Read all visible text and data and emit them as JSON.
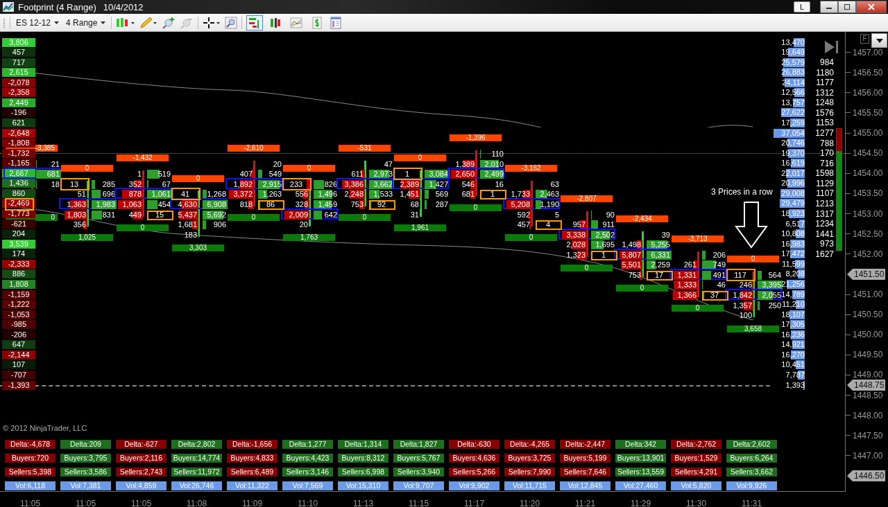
{
  "window": {
    "title": "Footprint (4 Range)",
    "date": "10/4/2012",
    "layout_button": "L"
  },
  "toolbar": {
    "instrument": "ES 12-12",
    "period": "4 Range",
    "chart_styles": [
      {
        "selected": true
      },
      {
        "selected": false
      },
      {
        "selected": false
      },
      {
        "selected": false
      }
    ]
  },
  "corner_button": "F",
  "delta_ladder": [
    "3,806",
    "457",
    "717",
    "2,615",
    "-2,078",
    "-2,358",
    "2,449",
    "-196",
    "621",
    "-2,648",
    "-1,808",
    "-1,732",
    "-1,165",
    "2,667",
    "1,436",
    "860",
    "-2,469",
    "-1,773",
    "-621",
    "204",
    "3,539",
    "174",
    "-2,333",
    "886",
    "1,808",
    "-1,159",
    "-1,222",
    "-1,053",
    "-985",
    "-206",
    "647",
    "-2,144",
    "107",
    "-707",
    "-1,393"
  ],
  "bars": [
    {
      "header": "-3,385",
      "footer": "0",
      "rows": [
        null,
        null,
        null,
        null,
        null,
        null,
        null,
        null,
        null,
        null,
        null,
        null,
        {
          "ask": "21",
          "imbalance": false,
          "bid_outlined": false,
          "ask_outlined": false
        },
        {
          "ask": "681",
          "imbalance": true,
          "bid_outlined": false,
          "ask_outlined": false
        },
        {
          "ask": "18",
          "imbalance": false,
          "bid_outlined": false,
          "ask_outlined": false
        },
        null,
        {
          "imbalance": false,
          "bid_outlined": true,
          "ask_outlined": false
        }
      ]
    },
    {
      "header": "0",
      "footer": "1,025",
      "rows": [
        null,
        null,
        null,
        null,
        null,
        null,
        null,
        null,
        null,
        null,
        null,
        null,
        null,
        null,
        {
          "bid": "13",
          "ask": "285",
          "imbalance": false,
          "bid_outlined": true,
          "ask_outlined": false
        },
        {
          "bid": "51",
          "ask": "696",
          "imbalance": false,
          "bid_outlined": false,
          "ask_outlined": false
        },
        {
          "bid": "1,363",
          "ask": "1,983",
          "imbalance": true,
          "bid_outlined": false,
          "ask_outlined": false
        },
        {
          "bid": "1,803",
          "ask": "831",
          "imbalance": false,
          "bid_outlined": false,
          "ask_outlined": false
        },
        {
          "bid": "356",
          "imbalance": false,
          "bid_outlined": false,
          "ask_outlined": false
        }
      ]
    },
    {
      "header": "-1,432",
      "footer": "0",
      "rows": [
        null,
        null,
        null,
        null,
        null,
        null,
        null,
        null,
        null,
        null,
        null,
        null,
        null,
        {
          "bid": "1",
          "ask": "519",
          "imbalance": false,
          "bid_outlined": false,
          "ask_outlined": false
        },
        {
          "bid": "352",
          "ask": "67",
          "imbalance": false,
          "bid_outlined": false,
          "ask_outlined": false
        },
        {
          "bid": "878",
          "ask": "1,061",
          "imbalance": true,
          "bid_outlined": false,
          "ask_outlined": false
        },
        {
          "bid": "1,063",
          "ask": "454",
          "imbalance": false,
          "bid_outlined": false,
          "ask_outlined": false
        },
        {
          "bid": "449",
          "ask": "15",
          "imbalance": false,
          "bid_outlined": false,
          "ask_outlined": true
        }
      ]
    },
    {
      "header": "0",
      "footer": "3,303",
      "rows": [
        null,
        null,
        null,
        null,
        null,
        null,
        null,
        null,
        null,
        null,
        null,
        null,
        null,
        null,
        null,
        {
          "bid": "41",
          "ask": "1,268",
          "imbalance": false,
          "bid_outlined": true,
          "ask_outlined": false
        },
        {
          "bid": "4,630",
          "ask": "6,908",
          "imbalance": true,
          "bid_outlined": false,
          "ask_outlined": false
        },
        {
          "bid": "5,437",
          "ask": "5,692",
          "imbalance": false,
          "bid_outlined": false,
          "ask_outlined": false
        },
        {
          "bid": "1,681",
          "ask": "906",
          "imbalance": false,
          "bid_outlined": false,
          "ask_outlined": false
        },
        {
          "bid": "183",
          "imbalance": false,
          "bid_outlined": false,
          "ask_outlined": false
        }
      ]
    },
    {
      "header": "-2,610",
      "footer": "0",
      "rows": [
        null,
        null,
        null,
        null,
        null,
        null,
        null,
        null,
        null,
        null,
        null,
        null,
        {
          "ask": "20",
          "imbalance": false,
          "bid_outlined": false,
          "ask_outlined": false
        },
        {
          "bid": "407",
          "ask": "549",
          "imbalance": false,
          "bid_outlined": false,
          "ask_outlined": false
        },
        {
          "bid": "1,892",
          "ask": "2,915",
          "imbalance": true,
          "bid_outlined": false,
          "ask_outlined": false
        },
        {
          "bid": "3,372",
          "ask": "1,263",
          "imbalance": false,
          "bid_outlined": false,
          "ask_outlined": false
        },
        {
          "bid": "818",
          "ask": "86",
          "imbalance": false,
          "bid_outlined": false,
          "ask_outlined": true
        }
      ]
    },
    {
      "header": "0",
      "footer": "1,763",
      "rows": [
        null,
        null,
        null,
        null,
        null,
        null,
        null,
        null,
        null,
        null,
        null,
        null,
        null,
        null,
        {
          "bid": "233",
          "ask": "826",
          "imbalance": false,
          "bid_outlined": true,
          "ask_outlined": false
        },
        {
          "bid": "556",
          "ask": "1,496",
          "imbalance": false,
          "bid_outlined": false,
          "ask_outlined": false
        },
        {
          "bid": "328",
          "ask": "1,459",
          "imbalance": false,
          "bid_outlined": false,
          "ask_outlined": false
        },
        {
          "bid": "2,009",
          "ask": "642",
          "imbalance": true,
          "bid_outlined": false,
          "ask_outlined": false
        },
        {
          "bid": "20",
          "imbalance": false,
          "bid_outlined": false,
          "ask_outlined": false
        }
      ]
    },
    {
      "header": "-531",
      "footer": "0",
      "rows": [
        null,
        null,
        null,
        null,
        null,
        null,
        null,
        null,
        null,
        null,
        null,
        null,
        {
          "ask": "47",
          "imbalance": false,
          "bid_outlined": false,
          "ask_outlined": false
        },
        {
          "bid": "611",
          "ask": "2,973",
          "imbalance": false,
          "bid_outlined": false,
          "ask_outlined": false
        },
        {
          "bid": "3,386",
          "ask": "3,662",
          "imbalance": true,
          "bid_outlined": false,
          "ask_outlined": false
        },
        {
          "bid": "2,248",
          "ask": "1,533",
          "imbalance": false,
          "bid_outlined": false,
          "ask_outlined": false
        },
        {
          "bid": "753",
          "ask": "92",
          "imbalance": false,
          "bid_outlined": false,
          "ask_outlined": true
        }
      ]
    },
    {
      "header": "0",
      "footer": "1,961",
      "rows": [
        null,
        null,
        null,
        null,
        null,
        null,
        null,
        null,
        null,
        null,
        null,
        null,
        null,
        {
          "bid": "1",
          "ask": "3,084",
          "imbalance": false,
          "bid_outlined": true,
          "ask_outlined": false
        },
        {
          "bid": "2,389",
          "ask": "1,427",
          "imbalance": true,
          "bid_outlined": false,
          "ask_outlined": false
        },
        {
          "bid": "1,451",
          "ask": "569",
          "imbalance": false,
          "bid_outlined": false,
          "ask_outlined": false
        },
        {
          "bid": "68",
          "ask": "287",
          "imbalance": false,
          "bid_outlined": false,
          "ask_outlined": false
        },
        {
          "bid": "31",
          "imbalance": false,
          "bid_outlined": false,
          "ask_outlined": false
        }
      ]
    },
    {
      "header": "-1,396",
      "footer": "0",
      "rows": [
        null,
        null,
        null,
        null,
        null,
        null,
        null,
        null,
        null,
        null,
        null,
        {
          "ask": "110",
          "imbalance": false,
          "bid_outlined": false,
          "ask_outlined": false
        },
        {
          "bid": "1,389",
          "ask": "2,010",
          "imbalance": false,
          "bid_outlined": false,
          "ask_outlined": false
        },
        {
          "bid": "2,650",
          "ask": "2,499",
          "imbalance": true,
          "bid_outlined": false,
          "ask_outlined": false
        },
        {
          "bid": "546",
          "ask": "16",
          "imbalance": false,
          "bid_outlined": false,
          "ask_outlined": false
        },
        {
          "bid": "681",
          "ask": "1",
          "imbalance": false,
          "bid_outlined": false,
          "ask_outlined": true
        }
      ]
    },
    {
      "header": "-3,162",
      "footer": "0",
      "rows": [
        null,
        null,
        null,
        null,
        null,
        null,
        null,
        null,
        null,
        null,
        null,
        null,
        null,
        null,
        {
          "ask": "63",
          "imbalance": false,
          "bid_outlined": false,
          "ask_outlined": false
        },
        {
          "bid": "1,733",
          "ask": "2,463",
          "imbalance": false,
          "bid_outlined": false,
          "ask_outlined": false
        },
        {
          "bid": "5,208",
          "ask": "1,190",
          "imbalance": true,
          "bid_outlined": false,
          "ask_outlined": false
        },
        {
          "bid": "592",
          "ask": "5",
          "imbalance": false,
          "bid_outlined": false,
          "ask_outlined": false
        },
        {
          "bid": "457",
          "ask": "4",
          "imbalance": false,
          "bid_outlined": false,
          "ask_outlined": true
        }
      ]
    },
    {
      "header": "-2,807",
      "footer": "0",
      "rows": [
        null,
        null,
        null,
        null,
        null,
        null,
        null,
        null,
        null,
        null,
        null,
        null,
        null,
        null,
        null,
        null,
        null,
        {
          "ask": "90",
          "imbalance": false,
          "bid_outlined": false,
          "ask_outlined": false
        },
        {
          "bid": "957",
          "ask": "911",
          "imbalance": false,
          "bid_outlined": false,
          "ask_outlined": false
        },
        {
          "bid": "3,338",
          "ask": "2,502",
          "imbalance": true,
          "bid_outlined": false,
          "ask_outlined": false
        },
        {
          "bid": "2,028",
          "ask": "1,695",
          "imbalance": false,
          "bid_outlined": false,
          "ask_outlined": false
        },
        {
          "bid": "1,323",
          "ask": "1",
          "imbalance": false,
          "bid_outlined": false,
          "ask_outlined": true
        }
      ]
    },
    {
      "header": "-2,434",
      "footer": "0",
      "rows": [
        null,
        null,
        null,
        null,
        null,
        null,
        null,
        null,
        null,
        null,
        null,
        null,
        null,
        null,
        null,
        null,
        null,
        null,
        null,
        {
          "ask": "39",
          "imbalance": false,
          "bid_outlined": false,
          "ask_outlined": false
        },
        {
          "bid": "1,498",
          "ask": "5,255",
          "imbalance": false,
          "bid_outlined": false,
          "ask_outlined": false
        },
        {
          "bid": "5,807",
          "ask": "6,331",
          "imbalance": true,
          "bid_outlined": false,
          "ask_outlined": false
        },
        {
          "bid": "5,501",
          "ask": "2,259",
          "imbalance": false,
          "bid_outlined": false,
          "ask_outlined": false
        },
        {
          "bid": "753",
          "ask": "17",
          "imbalance": false,
          "bid_outlined": false,
          "ask_outlined": true
        }
      ]
    },
    {
      "header": "-3,713",
      "footer": "0",
      "rows": [
        null,
        null,
        null,
        null,
        null,
        null,
        null,
        null,
        null,
        null,
        null,
        null,
        null,
        null,
        null,
        null,
        null,
        null,
        null,
        null,
        null,
        {
          "ask": "206",
          "imbalance": false,
          "bid_outlined": false,
          "ask_outlined": false
        },
        {
          "bid": "261",
          "ask": "749",
          "imbalance": false,
          "bid_outlined": false,
          "ask_outlined": false
        },
        {
          "bid": "1,331",
          "ask": "491",
          "imbalance": true,
          "bid_outlined": false,
          "ask_outlined": false
        },
        {
          "bid": "1,333",
          "ask": "46",
          "imbalance": false,
          "bid_outlined": false,
          "ask_outlined": false
        },
        {
          "bid": "1,366",
          "ask": "37",
          "imbalance": false,
          "bid_outlined": false,
          "ask_outlined": true
        }
      ]
    },
    {
      "header": "0",
      "footer": "3,658",
      "rows": [
        null,
        null,
        null,
        null,
        null,
        null,
        null,
        null,
        null,
        null,
        null,
        null,
        null,
        null,
        null,
        null,
        null,
        null,
        null,
        null,
        null,
        null,
        null,
        {
          "bid": "117",
          "ask": "564",
          "imbalance": false,
          "bid_outlined": true,
          "ask_outlined": false
        },
        {
          "bid": "246",
          "ask": "3,395",
          "imbalance": false,
          "bid_outlined": false,
          "ask_outlined": false
        },
        {
          "bid": "1,842",
          "ask": "2,055",
          "imbalance": true,
          "bid_outlined": false,
          "ask_outlined": false
        },
        {
          "bid": "1,357",
          "ask": "250",
          "imbalance": false,
          "bid_outlined": false,
          "ask_outlined": false
        },
        {
          "bid": "100",
          "imbalance": false,
          "bid_outlined": false,
          "ask_outlined": false
        }
      ]
    }
  ],
  "annotation": "3 Prices in a row",
  "volume_profile": [
    "13,470",
    "19,649",
    "25,579",
    "26,883",
    "24,114",
    "12,566",
    "13,757",
    "27,622",
    "17,259",
    "37,054",
    "20,746",
    "19,370",
    "16,619",
    "22,017",
    "20,996",
    "29,008",
    "29,479",
    "18,923",
    "6,517",
    "10,808",
    "16,983",
    "17,472",
    "11,599",
    "8,208",
    "21,256",
    "14,789",
    "11,210",
    "18,107",
    "17,305",
    "16,236",
    "14,921",
    "16,270",
    "10,451",
    "7,787",
    "1,393"
  ],
  "order_ladder": [
    "984",
    "1180",
    "1177",
    "1312",
    "1248",
    "1576",
    "1153",
    "1277",
    "788",
    "170",
    "716",
    "1598",
    "1129",
    "1107",
    "1213",
    "1317",
    "1234",
    "1441",
    "973",
    "1627"
  ],
  "price_axis": [
    {
      "label": "1457.00",
      "kind": "tick"
    },
    {
      "label": "1456.50",
      "kind": "tick"
    },
    {
      "label": "1456.00",
      "kind": "tick"
    },
    {
      "label": "1455.50",
      "kind": "tick"
    },
    {
      "label": "1455.00",
      "kind": "tick"
    },
    {
      "label": "1454.50",
      "kind": "tick"
    },
    {
      "label": "1454.00",
      "kind": "tick"
    },
    {
      "label": "1453.50",
      "kind": "tick"
    },
    {
      "label": "1453.00",
      "kind": "tick"
    },
    {
      "label": "1452.50",
      "kind": "tick"
    },
    {
      "label": "1452.00",
      "kind": "tick"
    },
    {
      "label": "1451.50",
      "kind": "marker"
    },
    {
      "label": "1451.00",
      "kind": "tick"
    },
    {
      "label": "1450.50",
      "kind": "tick"
    },
    {
      "label": "1450.00",
      "kind": "tick"
    },
    {
      "label": "1449.50",
      "kind": "tick"
    },
    {
      "label": "1449.00",
      "kind": "tick"
    },
    {
      "label": "1448.75",
      "kind": "marker"
    },
    {
      "label": "1448.50",
      "kind": "tick"
    },
    {
      "label": "1448.00",
      "kind": "tick"
    },
    {
      "label": "1447.50",
      "kind": "tick"
    },
    {
      "label": "1447.00",
      "kind": "tick"
    },
    {
      "label": "1446.50",
      "kind": "marker"
    }
  ],
  "summary": [
    {
      "delta": "Delta:-4,678",
      "buyers": "Buyers:720",
      "sellers": "Sellers:5,398",
      "vol": "Vol:6,118",
      "time": "11:05",
      "rising": false
    },
    {
      "delta": "Delta:209",
      "buyers": "Buyers:3,795",
      "sellers": "Sellers:3,586",
      "vol": "Vol:7,381",
      "time": "11:05",
      "rising": true
    },
    {
      "delta": "Delta:-627",
      "buyers": "Buyers:2,116",
      "sellers": "Sellers:2,743",
      "vol": "Vol:4,859",
      "time": "11:05",
      "rising": false
    },
    {
      "delta": "Delta:2,802",
      "buyers": "Buyers:14,774",
      "sellers": "Sellers:11,972",
      "vol": "Vol:26,746",
      "time": "11:08",
      "rising": true
    },
    {
      "delta": "Delta:-1,656",
      "buyers": "Buyers:4,833",
      "sellers": "Sellers:6,489",
      "vol": "Vol:11,322",
      "time": "11:09",
      "rising": false
    },
    {
      "delta": "Delta:1,277",
      "buyers": "Buyers:4,423",
      "sellers": "Sellers:3,146",
      "vol": "Vol:7,569",
      "time": "11:10",
      "rising": true
    },
    {
      "delta": "Delta:1,314",
      "buyers": "Buyers:8,312",
      "sellers": "Sellers:6,998",
      "vol": "Vol:15,310",
      "time": "11:13",
      "rising": true
    },
    {
      "delta": "Delta:1,827",
      "buyers": "Buyers:5,767",
      "sellers": "Sellers:3,940",
      "vol": "Vol:9,707",
      "time": "11:15",
      "rising": true
    },
    {
      "delta": "Delta:-630",
      "buyers": "Buyers:4,636",
      "sellers": "Sellers:5,266",
      "vol": "Vol:9,902",
      "time": "11:17",
      "rising": false
    },
    {
      "delta": "Delta:-4,265",
      "buyers": "Buyers:3,725",
      "sellers": "Sellers:7,990",
      "vol": "Vol:11,715",
      "time": "11:20",
      "rising": false
    },
    {
      "delta": "Delta:-2,447",
      "buyers": "Buyers:5,199",
      "sellers": "Sellers:7,646",
      "vol": "Vol:12,845",
      "time": "11:21",
      "rising": false
    },
    {
      "delta": "Delta:342",
      "buyers": "Buyers:13,901",
      "sellers": "Sellers:13,559",
      "vol": "Vol:27,460",
      "time": "11:29",
      "rising": true
    },
    {
      "delta": "Delta:-2,762",
      "buyers": "Buyers:1,529",
      "sellers": "Sellers:4,291",
      "vol": "Vol:5,820",
      "time": "11:30",
      "rising": false
    },
    {
      "delta": "Delta:2,602",
      "buyers": "Buyers:6,264",
      "sellers": "Sellers:3,662",
      "vol": "Vol:9,926",
      "time": "11:31",
      "rising": true
    }
  ],
  "copyright": "© 2012 NinjaTrader, LLC"
}
